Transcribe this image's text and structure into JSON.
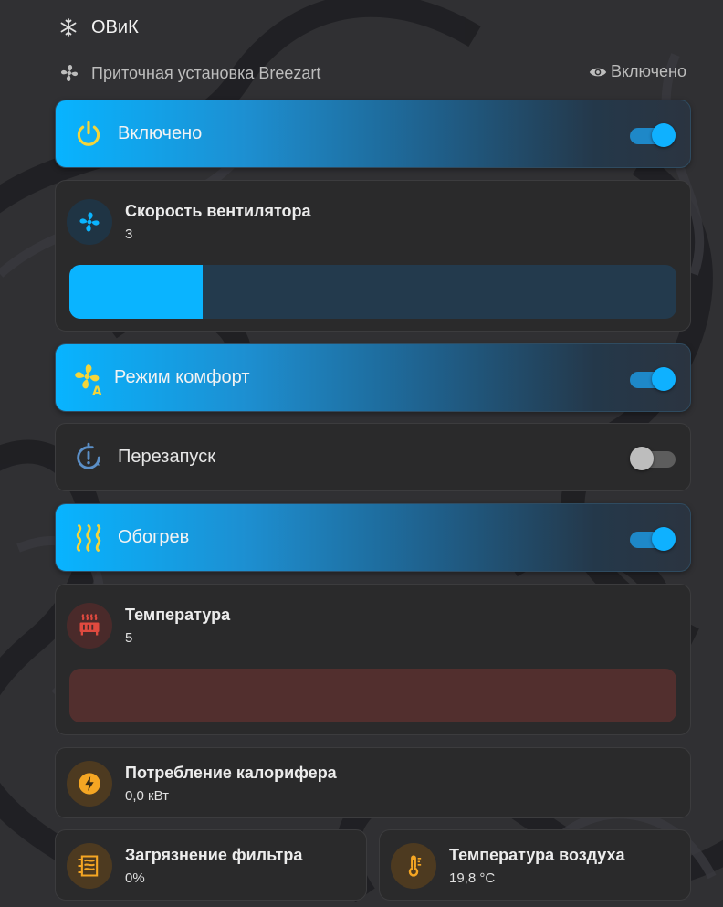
{
  "header": {
    "title": "ОВиК",
    "icon": "snowflake-thermometer-icon"
  },
  "device": {
    "name": "Приточная установка Breezart",
    "icon": "fan-icon",
    "visibility_label": "Включено",
    "visibility_icon": "eye-icon"
  },
  "power": {
    "label": "Включено",
    "icon": "power-icon",
    "state": "on",
    "icon_color": "#f3d53a"
  },
  "fan_speed": {
    "title": "Скорость вентилятора",
    "value": "3",
    "level": 0.22,
    "icon": "fan-icon",
    "accent": "#0ab4ff",
    "track": "#233a4d"
  },
  "comfort": {
    "label": "Режим комфорт",
    "icon": "fan-auto-icon",
    "state": "on",
    "icon_color": "#f3d53a"
  },
  "restart": {
    "label": "Перезапуск",
    "icon": "restart-alert-icon",
    "state": "off",
    "icon_color": "#5b8fc7"
  },
  "heating": {
    "label": "Обогрев",
    "icon": "heat-wave-icon",
    "state": "on",
    "icon_color": "#f3d53a"
  },
  "temperature": {
    "title": "Температура",
    "value": "5",
    "level": 0,
    "icon": "radiator-icon",
    "accent": "#e04a3f",
    "track": "#522f2e"
  },
  "heater_power": {
    "title": "Потребление калорифера",
    "value": "0,0 кВт",
    "icon": "lightning-icon",
    "accent": "#f5a623"
  },
  "filter": {
    "title": "Загрязнение фильтра",
    "value": "0%",
    "icon": "air-filter-icon",
    "accent": "#f5a623"
  },
  "air_temp": {
    "title": "Температура воздуха",
    "value": "19,8 °C",
    "icon": "thermometer-icon",
    "accent": "#f5a623"
  }
}
